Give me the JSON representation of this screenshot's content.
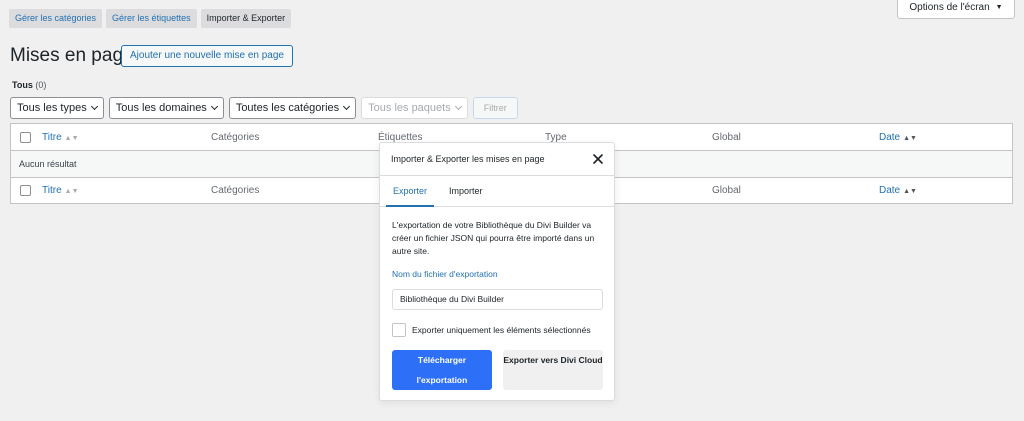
{
  "subnav": {
    "categories": "Gérer les catégories",
    "tags": "Gérer les étiquettes",
    "import_export": "Importer & Exporter"
  },
  "screen_options": {
    "label": "Options de l'écran",
    "caret": "▼"
  },
  "page": {
    "title": "Mises en page",
    "add_new": "Ajouter une nouvelle mise en page"
  },
  "views": {
    "all": "Tous",
    "count": "(0)"
  },
  "filters": {
    "types": "Tous les types",
    "domains": "Tous les domaines",
    "categories": "Toutes les catégories",
    "packs": "Tous les paquets",
    "filter_button": "Filtrer"
  },
  "table": {
    "columns": {
      "title": "Titre",
      "categories": "Catégories",
      "tags": "Étiquettes",
      "type": "Type",
      "global": "Global",
      "date": "Date"
    },
    "empty": "Aucun résultat",
    "sort_glyph": "▲▼"
  },
  "modal": {
    "title": "Importer & Exporter les mises en page",
    "tabs": {
      "export": "Exporter",
      "import": "Importer"
    },
    "description": "L'exportation de votre Bibliothèque du Divi Builder va créer un fichier JSON qui pourra être importé dans un autre site.",
    "filename_label": "Nom du fichier d'exportation",
    "filename_value": "Bibliothèque du Divi Builder",
    "selected_only": "Exporter uniquement les éléments sélectionnés",
    "download_button": "Télécharger l'exportation",
    "cloud_button": "Exporter vers Divi Cloud"
  },
  "colors": {
    "accent": "#2271b1",
    "primary_button": "#2d6ff7"
  }
}
